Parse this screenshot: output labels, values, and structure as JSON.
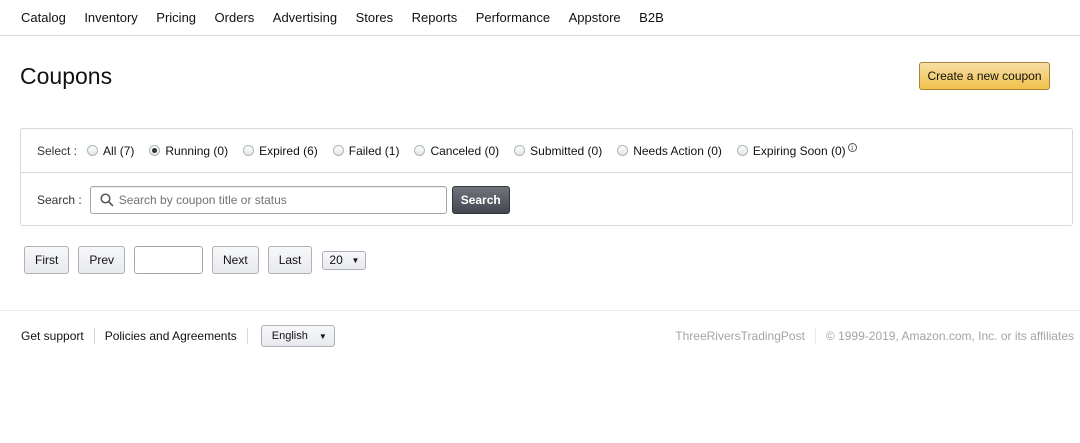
{
  "nav": {
    "items": [
      "Catalog",
      "Inventory",
      "Pricing",
      "Orders",
      "Advertising",
      "Stores",
      "Reports",
      "Performance",
      "Appstore",
      "B2B"
    ]
  },
  "page": {
    "title": "Coupons",
    "create_label": "Create a new coupon"
  },
  "filter": {
    "select_label": "Select :",
    "options": [
      {
        "label": "All (7)",
        "checked": false
      },
      {
        "label": "Running (0)",
        "checked": true
      },
      {
        "label": "Expired (6)",
        "checked": false
      },
      {
        "label": "Failed (1)",
        "checked": false
      },
      {
        "label": "Canceled (0)",
        "checked": false
      },
      {
        "label": "Submitted (0)",
        "checked": false
      },
      {
        "label": "Needs Action (0)",
        "checked": false
      },
      {
        "label": "Expiring Soon (0)",
        "checked": false
      }
    ],
    "info_icon": "info-icon",
    "search_label": "Search :",
    "search_placeholder": "Search by coupon title or status",
    "search_value": "",
    "search_button": "Search"
  },
  "pager": {
    "first": "First",
    "prev": "Prev",
    "page_value": "",
    "next": "Next",
    "last": "Last",
    "page_size": "20"
  },
  "footer": {
    "support": "Get support",
    "policies": "Policies and Agreements",
    "language": "English",
    "store_name": "ThreeRiversTradingPost",
    "copyright": "© 1999-2019, Amazon.com, Inc. or its affiliates"
  },
  "colors": {
    "accent_button": "#f0c14b",
    "dark_button": "#434750",
    "border": "#d5d9d9",
    "muted_text": "#a0a6a6"
  }
}
